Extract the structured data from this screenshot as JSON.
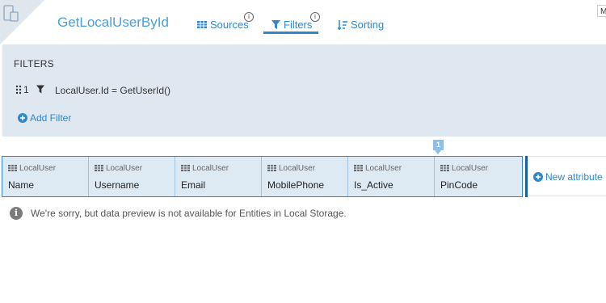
{
  "header": {
    "title": "GetLocalUserById",
    "tabs": [
      {
        "label": "Sources",
        "icon": "table-icon",
        "info": "i"
      },
      {
        "label": "Filters",
        "icon": "funnel-icon",
        "info": "i",
        "active": true
      },
      {
        "label": "Sorting",
        "icon": "sort-icon"
      }
    ],
    "corner_text": "M"
  },
  "filters": {
    "heading": "FILTERS",
    "items": [
      {
        "index": "1",
        "expression": "LocalUser.Id = GetUserId()"
      }
    ],
    "add_label": "Add Filter"
  },
  "table": {
    "columns": [
      {
        "source": "LocalUser",
        "name": "Name"
      },
      {
        "source": "LocalUser",
        "name": "Username"
      },
      {
        "source": "LocalUser",
        "name": "Email"
      },
      {
        "source": "LocalUser",
        "name": "MobilePhone"
      },
      {
        "source": "LocalUser",
        "name": "Is_Active"
      },
      {
        "source": "LocalUser",
        "name": "PinCode"
      }
    ],
    "marker": "1",
    "new_attribute_label": "New attribute"
  },
  "notice": {
    "text": "We're sorry, but data preview is not available for Entities in Local Storage."
  },
  "colors": {
    "accent": "#2f88c9",
    "panel_bg": "#dfe8f0",
    "table_bg": "#dde9f3"
  }
}
